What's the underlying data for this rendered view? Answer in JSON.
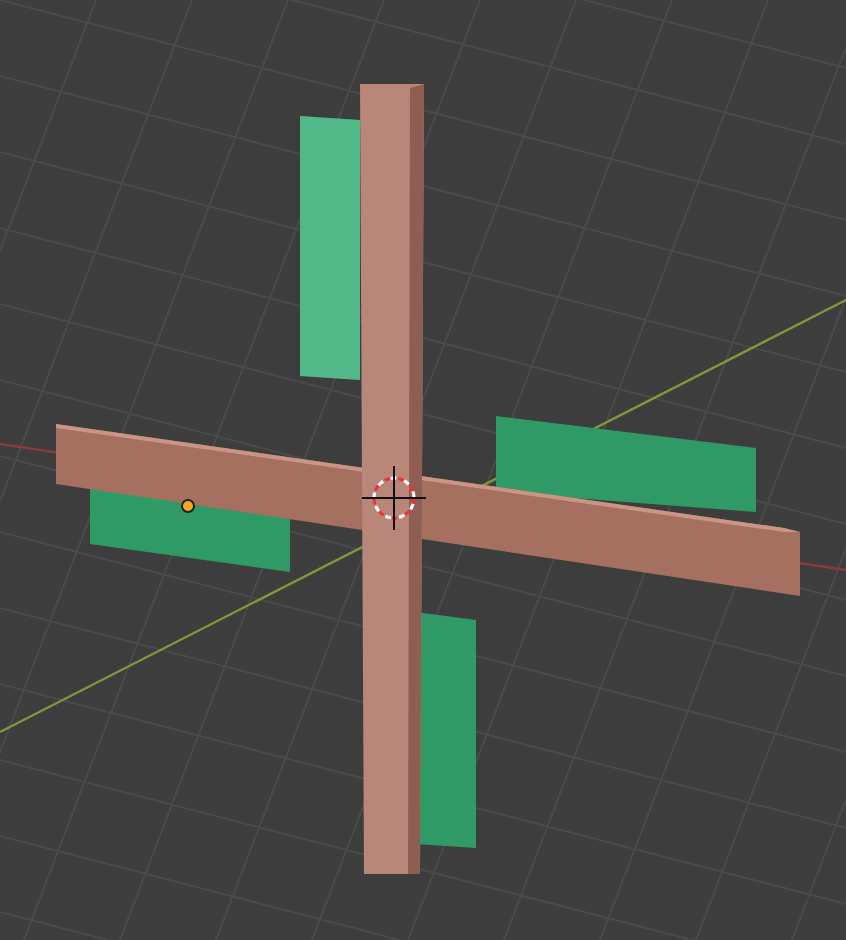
{
  "viewport": {
    "grid": true,
    "axes": true,
    "cursor_3d": true
  }
}
